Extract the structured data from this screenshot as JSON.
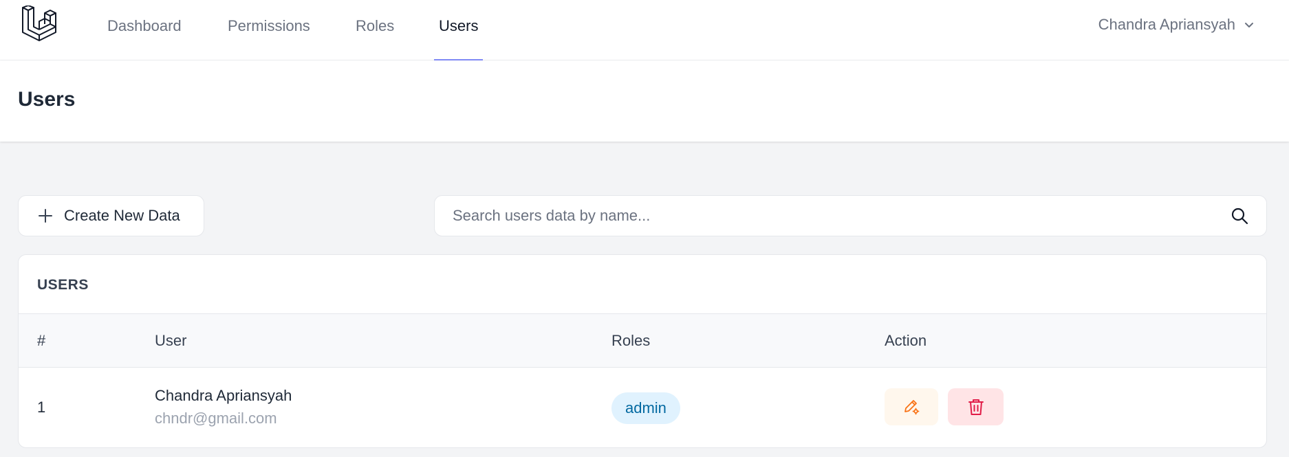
{
  "nav": {
    "items": [
      {
        "label": "Dashboard"
      },
      {
        "label": "Permissions"
      },
      {
        "label": "Roles"
      },
      {
        "label": "Users"
      }
    ],
    "active": "Users",
    "user_name": "Chandra Apriansyah",
    "user_menu_icon": "chevron-down-icon",
    "accent_color": "#818cf8"
  },
  "page": {
    "title": "Users"
  },
  "toolbar": {
    "create_label": "Create New Data",
    "create_icon": "plus-icon",
    "search_placeholder": "Search users data by name...",
    "search_value": "",
    "search_icon": "search-icon"
  },
  "table": {
    "title": "USERS",
    "columns": [
      "#",
      "User",
      "Roles",
      "Action"
    ],
    "rows": [
      {
        "index": "1",
        "name": "Chandra Apriansyah",
        "email": "chndr@gmail.com",
        "role": "admin",
        "actions": [
          "edit-icon",
          "trash-icon"
        ]
      }
    ]
  },
  "colors": {
    "role_badge_bg": "#e0f2fe",
    "role_badge_text": "#0369a1",
    "edit_bg": "#fff7ed",
    "edit_icon": "#f97316",
    "delete_bg": "#ffe4e6",
    "delete_icon": "#e11d48"
  }
}
